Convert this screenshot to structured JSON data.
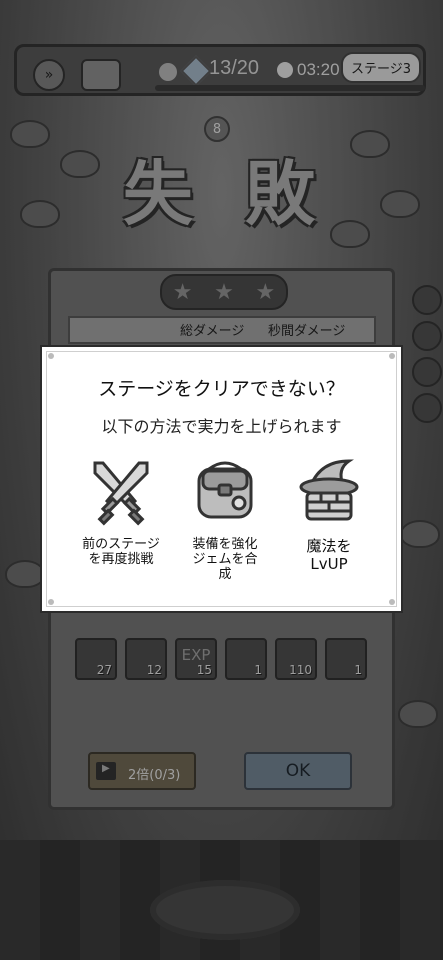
{
  "hud": {
    "wave": "13/20",
    "time": "03:20",
    "stage": "ステージ3",
    "speed_icon": "fast-forward-icon",
    "chest_icon": "treasure-chest-icon"
  },
  "wave_marker": "8",
  "fail_title": "失 敗",
  "result": {
    "stars": [
      "★",
      "★",
      "★"
    ],
    "total_damage_label": "総ダメージ",
    "dps_label": "秒間ダメージ",
    "items": [
      {
        "icon": "blue-scroll-icon",
        "glyph": "",
        "qty": "27"
      },
      {
        "icon": "blue-skill-book-icon",
        "glyph": "",
        "qty": "12"
      },
      {
        "icon": "exp-orb-icon",
        "glyph": "EXP",
        "qty": "15"
      },
      {
        "icon": "recipe-scroll-icon",
        "glyph": "",
        "qty": "1"
      },
      {
        "icon": "gold-coin-icon",
        "glyph": "",
        "qty": "110"
      },
      {
        "icon": "green-gem-icon",
        "glyph": "",
        "qty": "1"
      }
    ],
    "double_label": "2倍(0/3)",
    "ok_label": "OK"
  },
  "dialog": {
    "title": "ステージをクリアできない？",
    "subtitle": "以下の方法で実力を上げられます",
    "options": [
      {
        "icon": "crossed-swords-icon",
        "label_line1": "前のステージ",
        "label_line2": "を再度挑戦",
        "label_line3": ""
      },
      {
        "icon": "backpack-icon",
        "label_line1": "装備を強化",
        "label_line2": "ジェムを合",
        "label_line3": "成"
      },
      {
        "icon": "wizard-hat-icon",
        "label_line1": "魔法を",
        "label_line2": "LvUP",
        "label_line3": ""
      }
    ]
  },
  "colors": {
    "dialog_bg": "#ffffff",
    "ok_button": "#70808e",
    "double_button": "#6e6652"
  }
}
